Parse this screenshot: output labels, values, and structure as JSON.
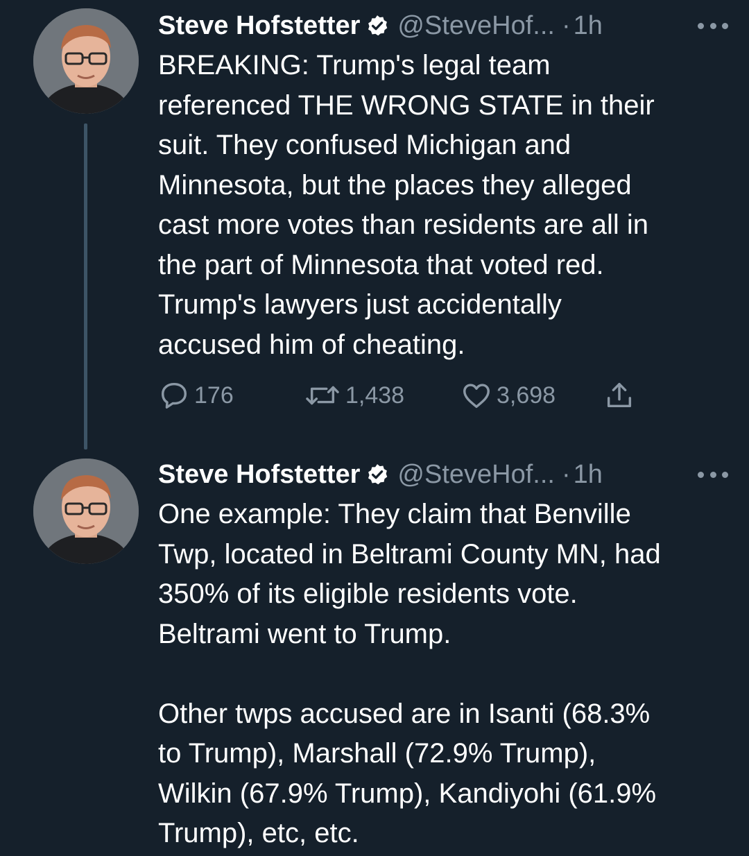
{
  "tweets": [
    {
      "author": {
        "name": "Steve Hofstetter",
        "handle": "@SteveHof...",
        "verified": true,
        "avatar_icon": "profile-photo"
      },
      "time": "1h",
      "separator": "·",
      "text": "BREAKING: Trump's legal team\nreferenced THE WRONG STATE in their\nsuit. They confused Michigan and\nMinnesota, but the places they alleged\ncast more votes than residents are all in\nthe part of Minnesota that voted red.\nTrump's lawyers just accidentally\naccused him of cheating.",
      "stats": {
        "replies": "176",
        "retweets": "1,438",
        "likes": "3,698"
      }
    },
    {
      "author": {
        "name": "Steve Hofstetter",
        "handle": "@SteveHof...",
        "verified": true,
        "avatar_icon": "profile-photo"
      },
      "time": "1h",
      "separator": "·",
      "text": "One example: They claim that Benville\nTwp, located in Beltrami County MN, had\n350% of its eligible residents vote.\nBeltrami went to Trump.\n\nOther twps accused are in Isanti (68.3%\nto Trump), Marshall (72.9% Trump),\nWilkin (67.9% Trump), Kandiyohi (61.9%\nTrump), etc, etc."
    }
  ],
  "colors": {
    "background": "#15202b",
    "text": "#ffffff",
    "secondary_text": "#8b98a5",
    "thread_line": "#3d5466"
  },
  "icons": [
    "verified-badge-icon",
    "more-icon",
    "reply-icon",
    "retweet-icon",
    "like-icon",
    "share-icon"
  ]
}
